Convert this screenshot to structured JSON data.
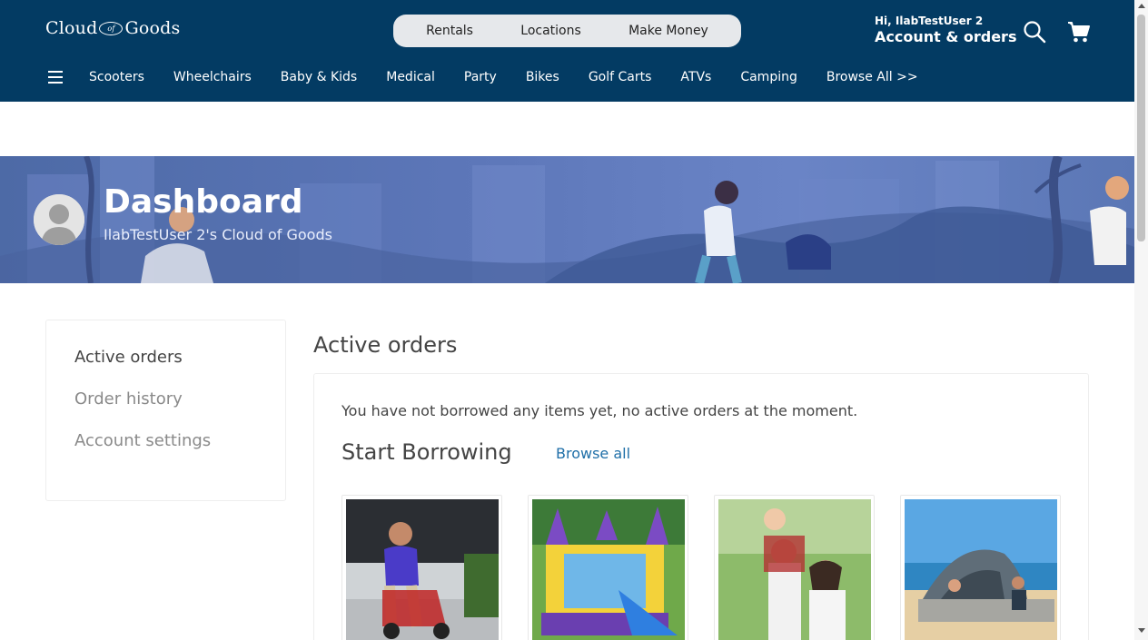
{
  "header": {
    "logo_left": "Cloud",
    "logo_of": "of",
    "logo_right": "Goods",
    "pill_nav": [
      "Rentals",
      "Locations",
      "Make Money"
    ],
    "greeting": "Hi, IlabTestUser 2",
    "account_label": "Account & orders",
    "search_icon": "search-icon",
    "cart_icon": "cart-icon",
    "menu_icon": "hamburger-menu-icon",
    "categories": [
      "Scooters",
      "Wheelchairs",
      "Baby & Kids",
      "Medical",
      "Party",
      "Bikes",
      "Golf Carts",
      "ATVs",
      "Camping",
      "Browse All >>"
    ]
  },
  "banner": {
    "title": "Dashboard",
    "subtitle": "IlabTestUser 2's Cloud of Goods",
    "avatar_icon": "user-avatar-icon"
  },
  "sidebar": {
    "items": [
      "Active orders",
      "Order history",
      "Account settings"
    ],
    "active_index": 0
  },
  "main": {
    "title": "Active orders",
    "empty_message": "You have not borrowed any items yet, no active orders at the moment.",
    "start_title": "Start Borrowing",
    "browse_all": "Browse all",
    "products": [
      {
        "image": "mobility-scooter-photo"
      },
      {
        "image": "bounce-house-photo"
      },
      {
        "image": "baby-carrier-hiking-photo"
      },
      {
        "image": "beach-tent-photo"
      }
    ]
  },
  "colors": {
    "header_bg": "#033b63",
    "pill_bg": "#e6e8eb",
    "link": "#1f6fa8",
    "banner_bg": "#5c76b8"
  }
}
